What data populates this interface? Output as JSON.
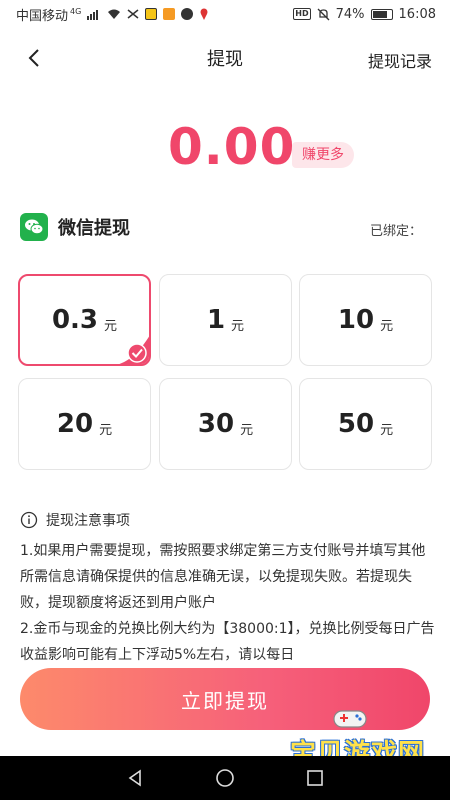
{
  "status_bar": {
    "carrier": "中国移动",
    "network": "4G",
    "battery": "74%",
    "time": "16:08"
  },
  "header": {
    "title": "提现",
    "records_link": "提现记录"
  },
  "balance": {
    "amount": "0.00",
    "earn_more": "赚更多"
  },
  "wechat": {
    "label": "微信提现",
    "bound_label": "已绑定："
  },
  "amounts": [
    {
      "value": "0.3",
      "unit": "元",
      "selected": true
    },
    {
      "value": "1",
      "unit": "元",
      "selected": false
    },
    {
      "value": "10",
      "unit": "元",
      "selected": false
    },
    {
      "value": "20",
      "unit": "元",
      "selected": false
    },
    {
      "value": "30",
      "unit": "元",
      "selected": false
    },
    {
      "value": "50",
      "unit": "元",
      "selected": false
    }
  ],
  "notes": {
    "title": "提现注意事项",
    "line1": "1.如果用户需要提现，需按照要求绑定第三方支付账号并填写其他所需信息请确保提供的信息准确无误，以免提现失败。若提现失败，提现额度将返还到用户账户",
    "line2": " 2.金币与现金的兑换比例大约为【38000:1】，兑换比例受每日广告收益影响可能有上下浮动5%左右，请以每日"
  },
  "action_button": {
    "label": "立即提现"
  },
  "watermark": {
    "text": "宝贝游戏网",
    "url": "baobeiy.com"
  },
  "colors": {
    "accent": "#f0466a",
    "wechat_green": "#22b14c",
    "button_gradient_start": "#fd8a6b",
    "button_gradient_end": "#f0466a"
  }
}
